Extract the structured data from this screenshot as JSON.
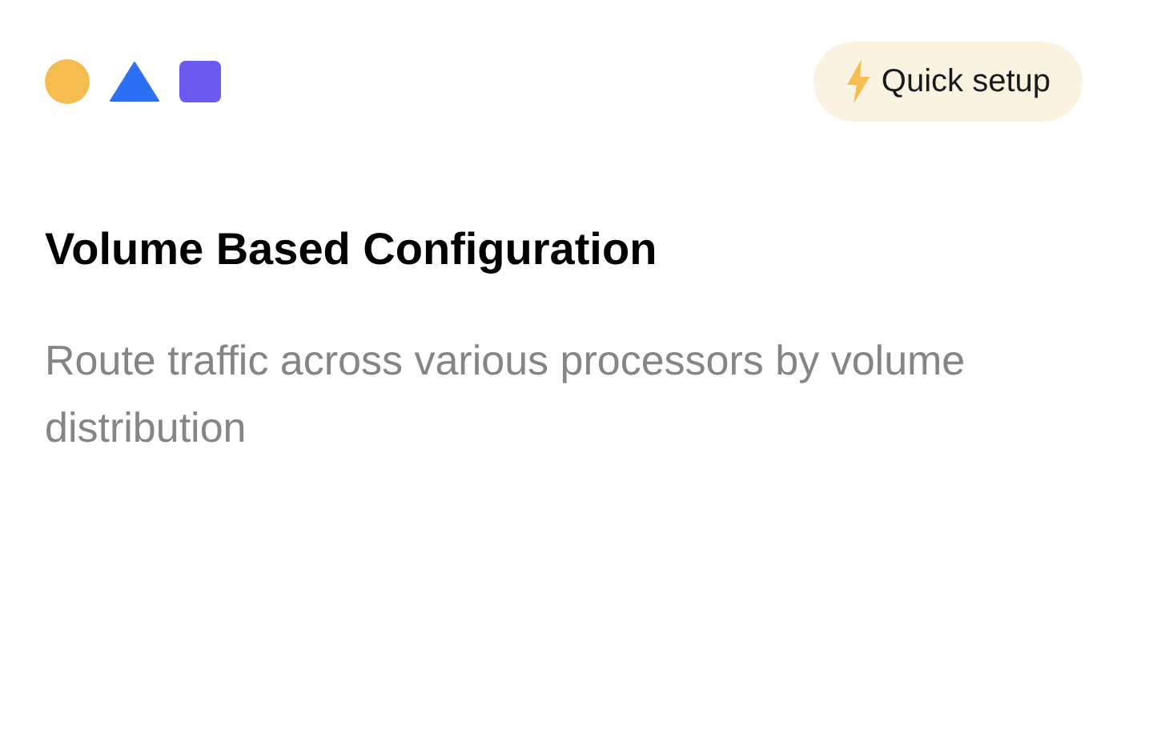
{
  "badge": {
    "label": "Quick setup"
  },
  "title": "Volume Based Configuration",
  "description": "Route traffic across various processors by volume distribution"
}
